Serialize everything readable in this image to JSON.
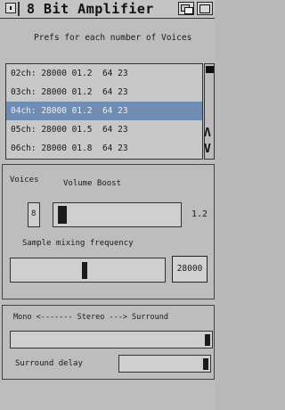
{
  "window": {
    "title": "8 Bit Amplifier"
  },
  "prefs_heading": "Prefs for each number of Voices",
  "voice_list": [
    {
      "label": "02ch: 28000 01.2  64 23",
      "selected": false
    },
    {
      "label": "03ch: 28000 01.2  64 23",
      "selected": false
    },
    {
      "label": "04ch: 28000 01.2  64 23",
      "selected": true
    },
    {
      "label": "05ch: 28000 01.5  64 23",
      "selected": false
    },
    {
      "label": "06ch: 28000 01.8  64 23",
      "selected": false
    }
  ],
  "scroll": {
    "up_arrow": "Λ",
    "down_arrow": "V"
  },
  "voices_group": {
    "voices_label": "Voices",
    "volume_boost_label": "Volume Boost",
    "voices_value": "8",
    "volume_boost_value": "1.2",
    "sample_freq_label": "Sample mixing frequency",
    "sample_freq_value": "28000"
  },
  "stereo_group": {
    "stereo_label": "Mono <------- Stereo ---> Surround",
    "surround_delay_label": "Surround delay"
  },
  "colors": {
    "background": "#bdbdbd",
    "selection": "#6f8db3",
    "text": "#1a1a1a"
  }
}
